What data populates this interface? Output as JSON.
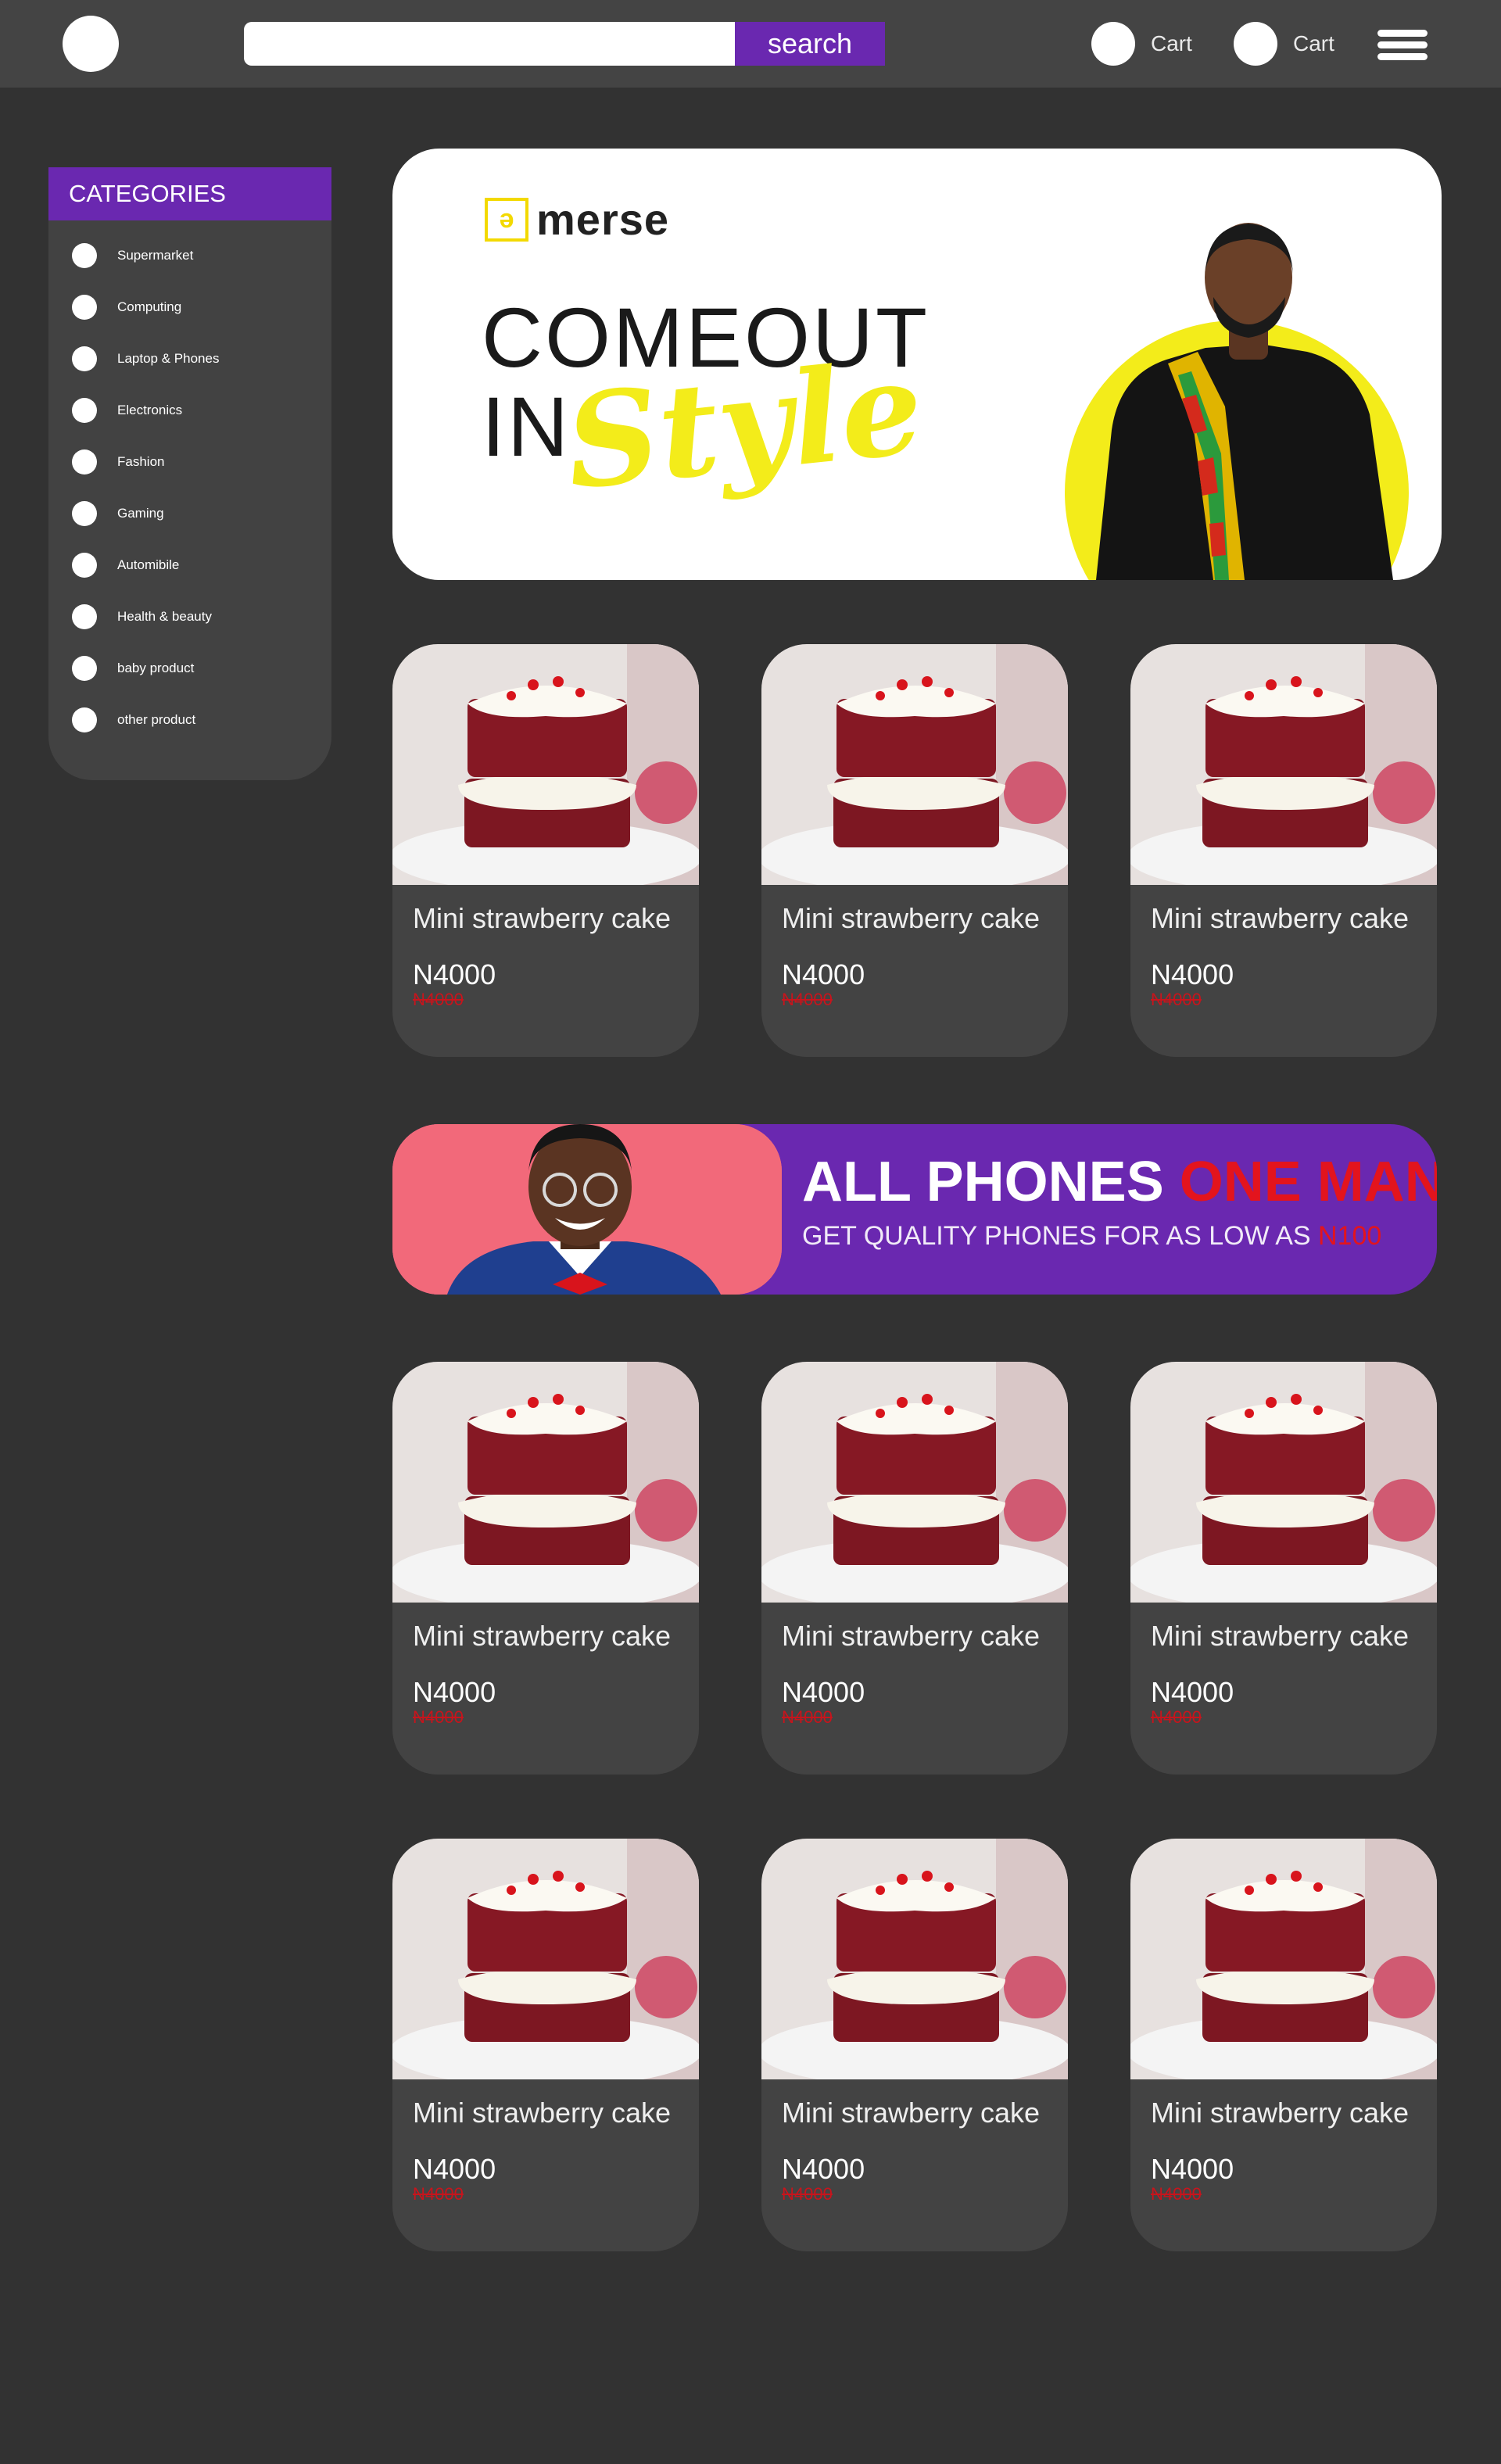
{
  "header": {
    "search_placeholder": "",
    "search_button": "search",
    "cart_labels": [
      "Cart",
      "Cart"
    ]
  },
  "sidebar": {
    "title": "CATEGORIES",
    "items": [
      "Supermarket",
      "Computing",
      "Laptop & Phones",
      "Electronics",
      "Fashion",
      "Gaming",
      "Automibile",
      "Health & beauty",
      "baby product",
      "other product"
    ]
  },
  "hero": {
    "brand": "merse",
    "line1": "COMEOUT",
    "line2": "IN",
    "line2_script": "Style",
    "accent_color": "#f3ec1a"
  },
  "products_row1": [
    {
      "name": "Mini strawberry cake",
      "price": "N4000",
      "old_price": "N4000"
    },
    {
      "name": "Mini strawberry cake",
      "price": "N4000",
      "old_price": "N4000"
    },
    {
      "name": "Mini strawberry cake",
      "price": "N4000",
      "old_price": "N4000"
    }
  ],
  "promo": {
    "title_part1": "ALL PHONES",
    "title_part2": "ONE MAN",
    "subtitle": "GET QUALITY PHONES FOR AS LOW AS",
    "subtitle_price": "N100",
    "bg_color": "#6a28b0",
    "accent_color": "#e3141d"
  },
  "products_row2": [
    {
      "name": "Mini strawberry cake",
      "price": "N4000",
      "old_price": "N4000"
    },
    {
      "name": "Mini strawberry cake",
      "price": "N4000",
      "old_price": "N4000"
    },
    {
      "name": "Mini strawberry cake",
      "price": "N4000",
      "old_price": "N4000"
    }
  ],
  "products_row3": [
    {
      "name": "Mini strawberry cake",
      "price": "N4000",
      "old_price": "N4000"
    },
    {
      "name": "Mini strawberry cake",
      "price": "N4000",
      "old_price": "N4000"
    },
    {
      "name": "Mini strawberry cake",
      "price": "N4000",
      "old_price": "N4000"
    }
  ],
  "colors": {
    "background": "#323232",
    "header": "#444444",
    "card": "#434343",
    "brand_purple": "#6a28b0"
  }
}
